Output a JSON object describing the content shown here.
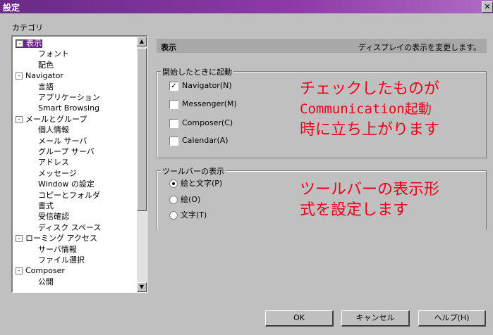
{
  "window": {
    "title": "設定",
    "close_icon": "close-icon"
  },
  "category": {
    "label": "カテゴリ",
    "tree": [
      {
        "label": "表示",
        "level": 0,
        "expander": "-",
        "selected": true
      },
      {
        "label": "フォント",
        "level": 1
      },
      {
        "label": "配色",
        "level": 1
      },
      {
        "label": "Navigator",
        "level": 0,
        "expander": "-"
      },
      {
        "label": "言語",
        "level": 1
      },
      {
        "label": "アプリケーション",
        "level": 1
      },
      {
        "label": "Smart Browsing",
        "level": 1
      },
      {
        "label": "メールとグループ",
        "level": 0,
        "expander": "-"
      },
      {
        "label": "個人情報",
        "level": 1
      },
      {
        "label": "メール サーバ",
        "level": 1
      },
      {
        "label": "グループ サーバ",
        "level": 1
      },
      {
        "label": "アドレス",
        "level": 1
      },
      {
        "label": "メッセージ",
        "level": 1
      },
      {
        "label": "Window の設定",
        "level": 1
      },
      {
        "label": "コピーとフォルダ",
        "level": 1
      },
      {
        "label": "書式",
        "level": 1
      },
      {
        "label": "受信確認",
        "level": 1
      },
      {
        "label": "ディスク スペース",
        "level": 1
      },
      {
        "label": "ローミング アクセス",
        "level": 0,
        "expander": "-"
      },
      {
        "label": "サーバ情報",
        "level": 1
      },
      {
        "label": "ファイル選択",
        "level": 1
      },
      {
        "label": "Composer",
        "level": 0,
        "expander": "-"
      },
      {
        "label": "公開",
        "level": 1
      }
    ]
  },
  "panel": {
    "title": "表示",
    "description": "ディスプレイの表示を変更します。",
    "startup_group": {
      "title": "開始したときに起動",
      "options": [
        {
          "label": "Navigator(N)",
          "checked": true
        },
        {
          "label": "Messenger(M)",
          "checked": false
        },
        {
          "label": "Composer(C)",
          "checked": false
        },
        {
          "label": "Calendar(A)",
          "checked": false
        }
      ]
    },
    "toolbar_group": {
      "title": "ツールバーの表示",
      "options": [
        {
          "label": "絵と文字(P)",
          "selected": true
        },
        {
          "label": "絵(O)",
          "selected": false
        },
        {
          "label": "文字(T)",
          "selected": false
        }
      ]
    }
  },
  "annotations": {
    "note1_line1": "チェックしたものが",
    "note1_line2": "Communication起動",
    "note1_line3": "時に立ち上がります",
    "note2_line1": "ツールバーの表示形",
    "note2_line2": "式を設定します",
    "color": "#e8001c"
  },
  "buttons": {
    "ok": "OK",
    "cancel": "キャンセル",
    "help": "ヘルプ(H)"
  }
}
